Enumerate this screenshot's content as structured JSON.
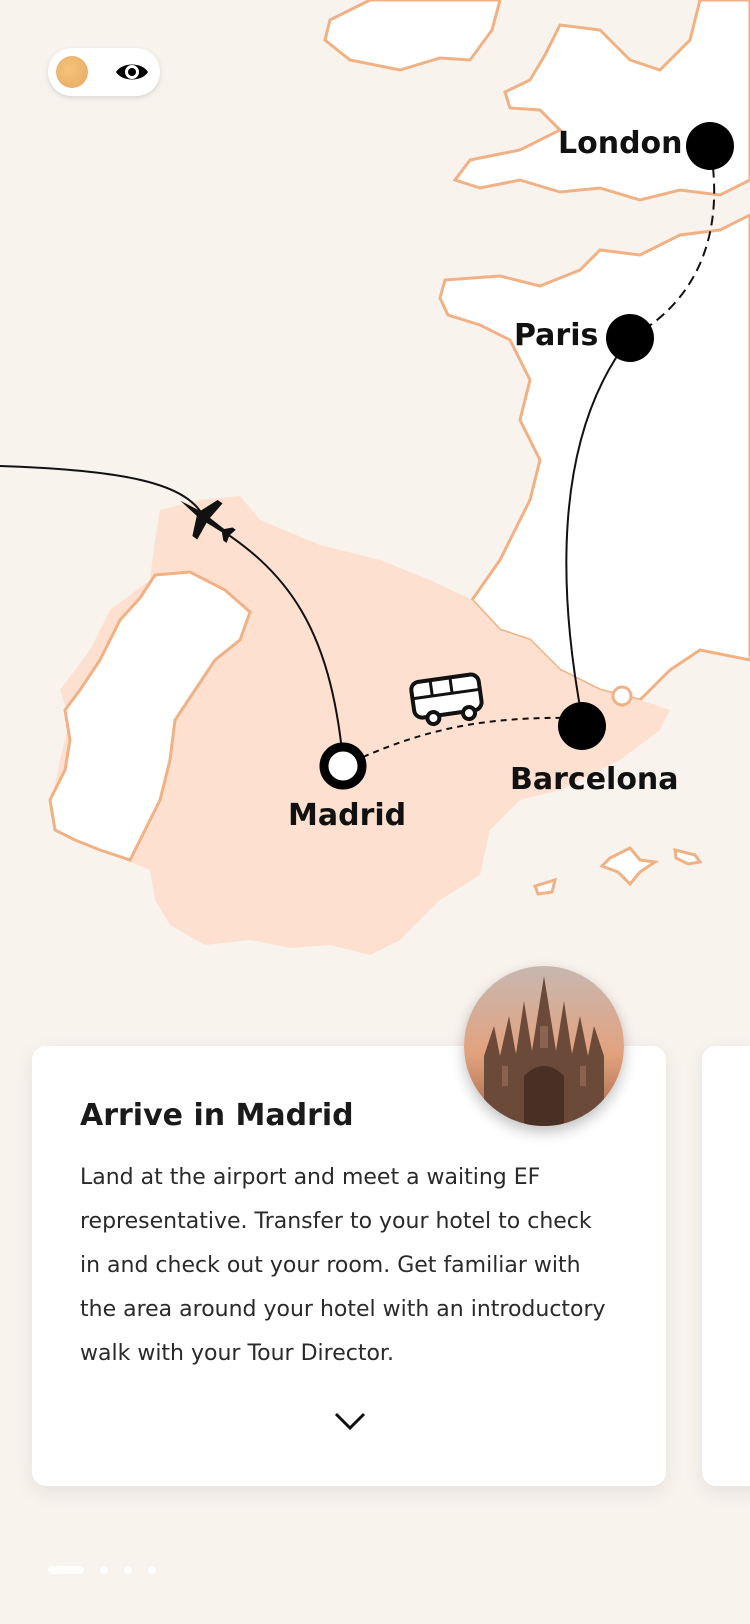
{
  "map": {
    "cities": [
      {
        "name": "London"
      },
      {
        "name": "Paris"
      },
      {
        "name": "Barcelona"
      },
      {
        "name": "Madrid"
      }
    ],
    "colors": {
      "background": "#f9f3ee",
      "land": "#ffffff",
      "coast": "#f0b184",
      "highlight_country": "#fde0cf",
      "route": "#111111"
    }
  },
  "controls": {
    "toggle_icons": [
      "sun-dot-icon",
      "eye-icon"
    ]
  },
  "card": {
    "title": "Arrive in Madrid",
    "body": "Land at the airport and meet a waiting EF representative. Transfer to your hotel to check in and check out your room. Get familiar with the area around your hotel with an introductory walk with your Tour Director.",
    "expand_icon": "chevron-down-icon",
    "photo": "cathedral-photo"
  },
  "pager": {
    "total": 4,
    "current": 1
  }
}
